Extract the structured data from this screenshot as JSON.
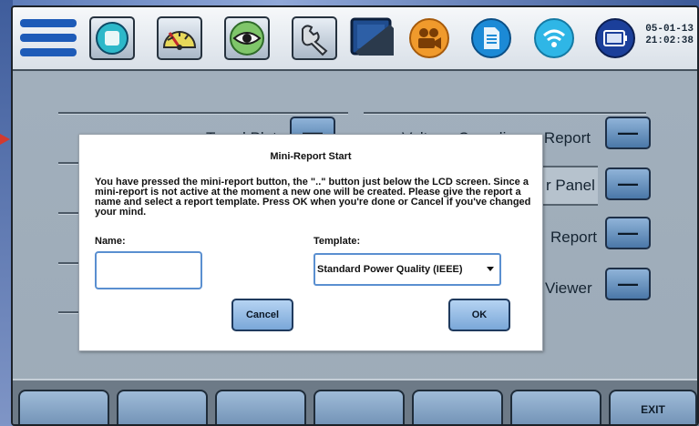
{
  "header": {
    "date": "05-01-13",
    "time": "21:02:38"
  },
  "toolbar": {
    "icons": [
      "menu-icon",
      "scope-icon",
      "meter-icon",
      "eye-icon",
      "wrench-icon",
      "monitor-icon",
      "camera-icon",
      "document-icon",
      "wireless-icon",
      "battery-icon"
    ]
  },
  "background": {
    "left_label": "Trend Plot",
    "right_labels": [
      "Voltage Compliance Report",
      "r Panel",
      "Report",
      "Viewer"
    ],
    "button_label": "—"
  },
  "dialog": {
    "title": "Mini-Report Start",
    "message": "You have pressed the mini-report button, the \"..\" button just below the LCD screen.  Since a mini-report is not active at the moment a new one will be created.  Please give the report a name and select a report template.  Press OK when you're done or Cancel if you've changed your mind.",
    "name_label": "Name:",
    "name_value": "",
    "template_label": "Template:",
    "template_value": "Standard Power Quality (IEEE)",
    "cancel_label": "Cancel",
    "ok_label": "OK"
  },
  "bottombar": {
    "keys": [
      "",
      "",
      "",
      "",
      "",
      "",
      "EXIT"
    ]
  },
  "colors": {
    "accent_blue": "#1f6fd1",
    "screen_bg": "#a2b0bd"
  }
}
